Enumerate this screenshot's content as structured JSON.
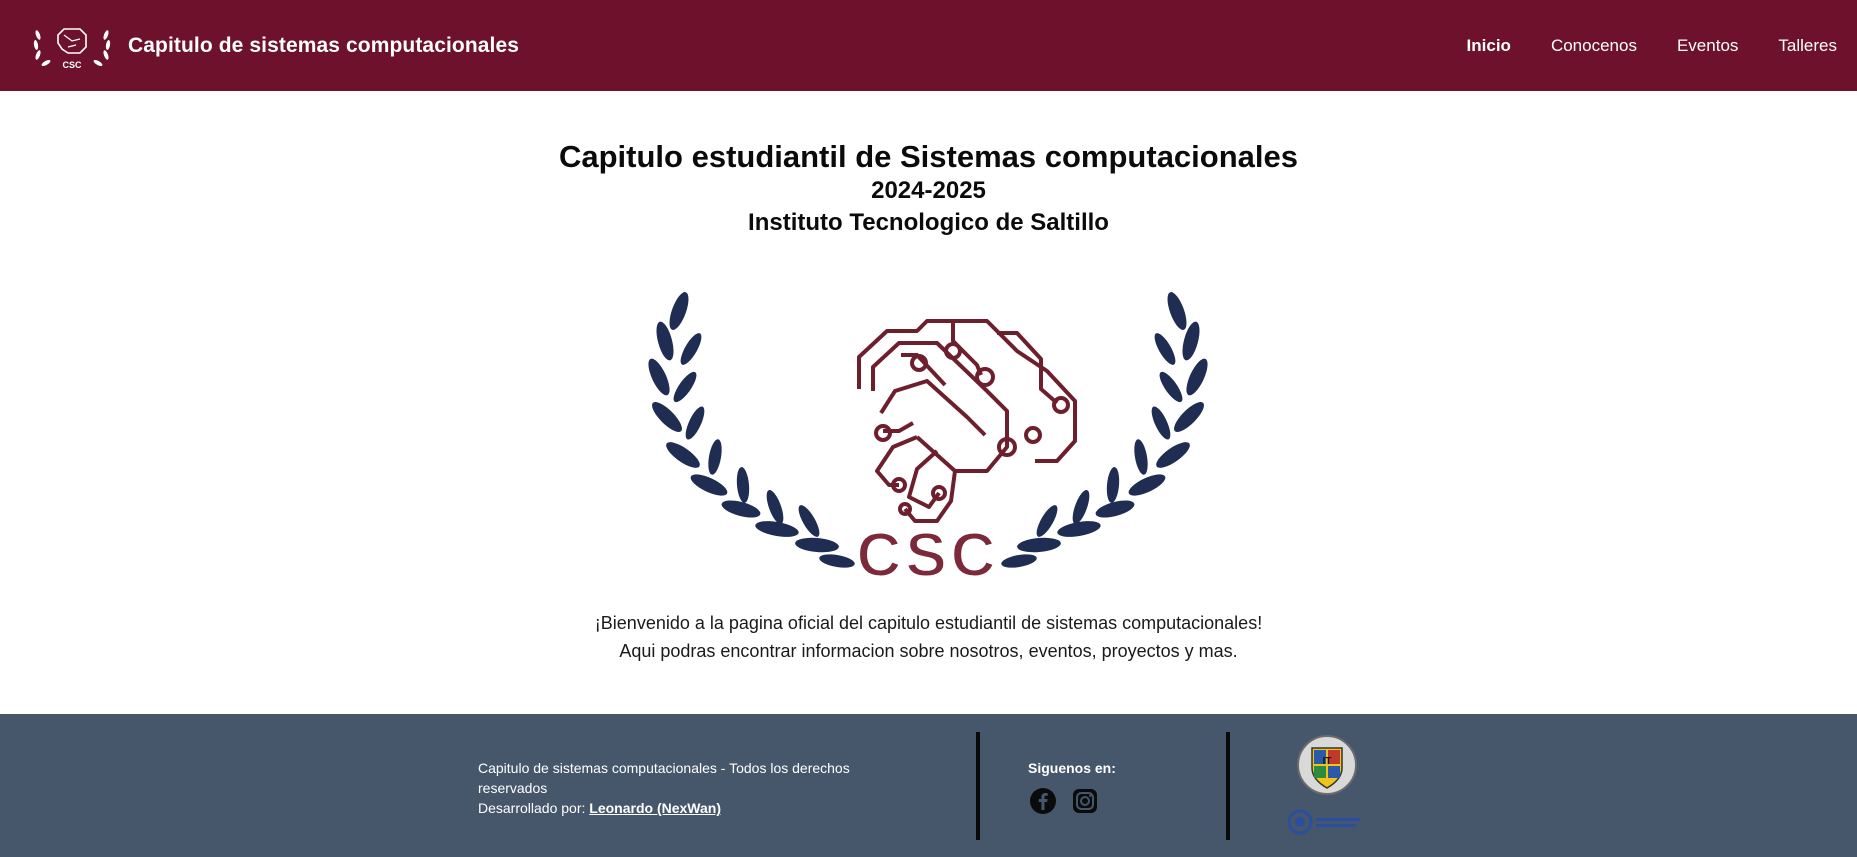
{
  "header": {
    "title": "Capitulo de sistemas computacionales",
    "logo_icon": "csc-laurel-brain-logo",
    "nav": [
      {
        "label": "Inicio",
        "active": true
      },
      {
        "label": "Conocenos",
        "active": false
      },
      {
        "label": "Eventos",
        "active": false
      },
      {
        "label": "Talleres",
        "active": false
      }
    ]
  },
  "main": {
    "title": "Capitulo estudiantil de Sistemas computacionales",
    "years": "2024-2025",
    "institute": "Instituto Tecnologico de Saltillo",
    "hero_icon": "csc-brain-laurel-emblem",
    "welcome_line1": "¡Bienvenido a la pagina oficial del capitulo estudiantil de sistemas computacionales!",
    "welcome_line2": "Aqui podras encontrar informacion sobre nosotros, eventos, proyectos y mas."
  },
  "footer": {
    "rights": "Capitulo de sistemas computacionales - Todos los derechos reservados",
    "developed_by": "Desarrollado por:",
    "developer": "Leonardo (NexWan)",
    "follow_label": "Siguenos en:",
    "social": [
      "facebook-icon",
      "instagram-icon"
    ]
  },
  "colors": {
    "header_bg": "#6d112c",
    "footer_bg": "#46566b",
    "brain_maroon": "#6e1f2e",
    "laurel_navy": "#1f2d52"
  }
}
